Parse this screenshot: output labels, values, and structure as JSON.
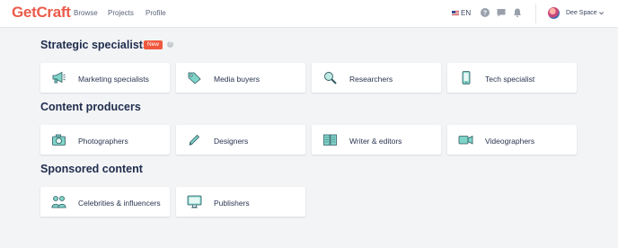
{
  "header": {
    "logo": "GetCraft",
    "nav": [
      "Browse",
      "Projects",
      "Profile"
    ],
    "language": "EN",
    "user_name": "Dee Space",
    "icons": [
      "help-icon",
      "chat-icon",
      "bell-icon",
      "chevron-down-icon"
    ]
  },
  "sections": [
    {
      "title": "Strategic specialists",
      "badge": "New",
      "help": "?",
      "cards": [
        {
          "label": "Marketing specialists",
          "icon": "megaphone-icon"
        },
        {
          "label": "Media buyers",
          "icon": "tag-icon"
        },
        {
          "label": "Researchers",
          "icon": "magnifier-icon"
        },
        {
          "label": "Tech specialist",
          "icon": "phone-icon"
        }
      ]
    },
    {
      "title": "Content producers",
      "cards": [
        {
          "label": "Photographers",
          "icon": "camera-icon"
        },
        {
          "label": "Designers",
          "icon": "pen-icon"
        },
        {
          "label": "Writer & editors",
          "icon": "book-icon"
        },
        {
          "label": "Videographers",
          "icon": "video-camera-icon"
        }
      ]
    },
    {
      "title": "Sponsored content",
      "cards": [
        {
          "label": "Celebrities & influencers",
          "icon": "people-icon"
        },
        {
          "label": "Publishers",
          "icon": "monitor-icon"
        }
      ]
    }
  ],
  "colors": {
    "brand": "#ea5b4a",
    "badge": "#f0583e",
    "icon_teal": "#7fd4c8",
    "text_dark": "#1f2d4d",
    "background": "#f3f4f6"
  }
}
